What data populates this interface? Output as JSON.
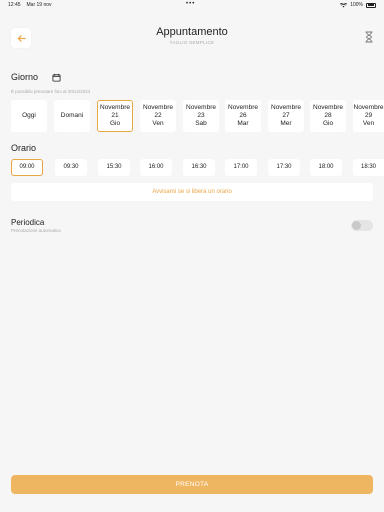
{
  "status": {
    "time": "12:45",
    "date": "Mar 19 nov",
    "dots": "•••",
    "battery": "100%"
  },
  "header": {
    "title": "Appuntamento",
    "subtitle": "TAGLIO SEMPLICE"
  },
  "day_section": {
    "label": "Giorno",
    "hint": "È possibile prenotare fino al 30/12/2024",
    "days": [
      {
        "line1": "Oggi",
        "line2": "",
        "line3": ""
      },
      {
        "line1": "Domani",
        "line2": "",
        "line3": ""
      },
      {
        "line1": "Novembre",
        "line2": "21",
        "line3": "Gio"
      },
      {
        "line1": "Novembre",
        "line2": "22",
        "line3": "Ven"
      },
      {
        "line1": "Novembre",
        "line2": "23",
        "line3": "Sab"
      },
      {
        "line1": "Novembre",
        "line2": "26",
        "line3": "Mar"
      },
      {
        "line1": "Novembre",
        "line2": "27",
        "line3": "Mer"
      },
      {
        "line1": "Novembre",
        "line2": "28",
        "line3": "Gio"
      },
      {
        "line1": "Novembre",
        "line2": "29",
        "line3": "Ven"
      }
    ],
    "selected_index": 2
  },
  "time_section": {
    "label": "Orario",
    "times": [
      "09:00",
      "09:30",
      "15:30",
      "16:00",
      "16:30",
      "17:00",
      "17:30",
      "18:00",
      "18:30"
    ],
    "selected_index": 0,
    "notify_label": "Avvisami se si libera un orario"
  },
  "periodic": {
    "title": "Periodica",
    "subtitle": "Prenotazione automatica",
    "enabled": false
  },
  "footer": {
    "book_label": "PRENOTA"
  },
  "colors": {
    "accent": "#e9a645",
    "button": "#efb662",
    "background": "#f6f6f6"
  }
}
